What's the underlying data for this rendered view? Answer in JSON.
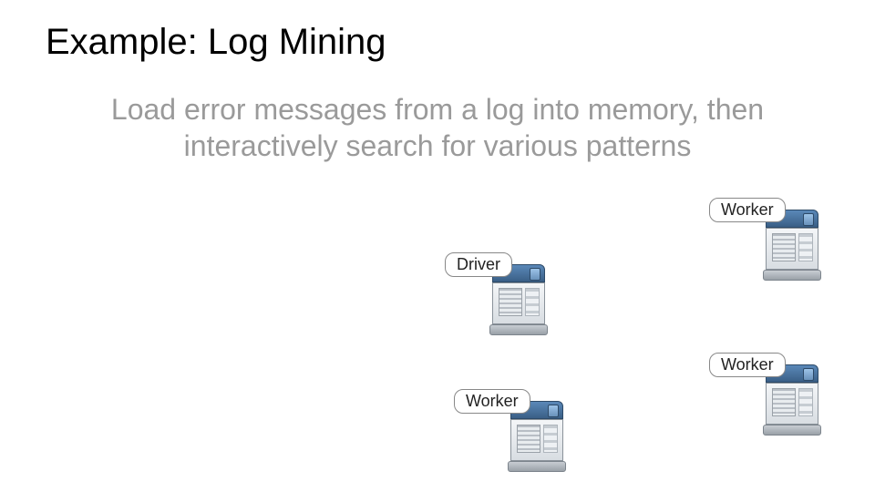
{
  "title": "Example: Log Mining",
  "subtitle": "Load error messages from a log into memory, then interactively search for various patterns",
  "nodes": {
    "driver": {
      "label": "Driver"
    },
    "worker1": {
      "label": "Worker"
    },
    "worker2": {
      "label": "Worker"
    },
    "worker3": {
      "label": "Worker"
    }
  }
}
